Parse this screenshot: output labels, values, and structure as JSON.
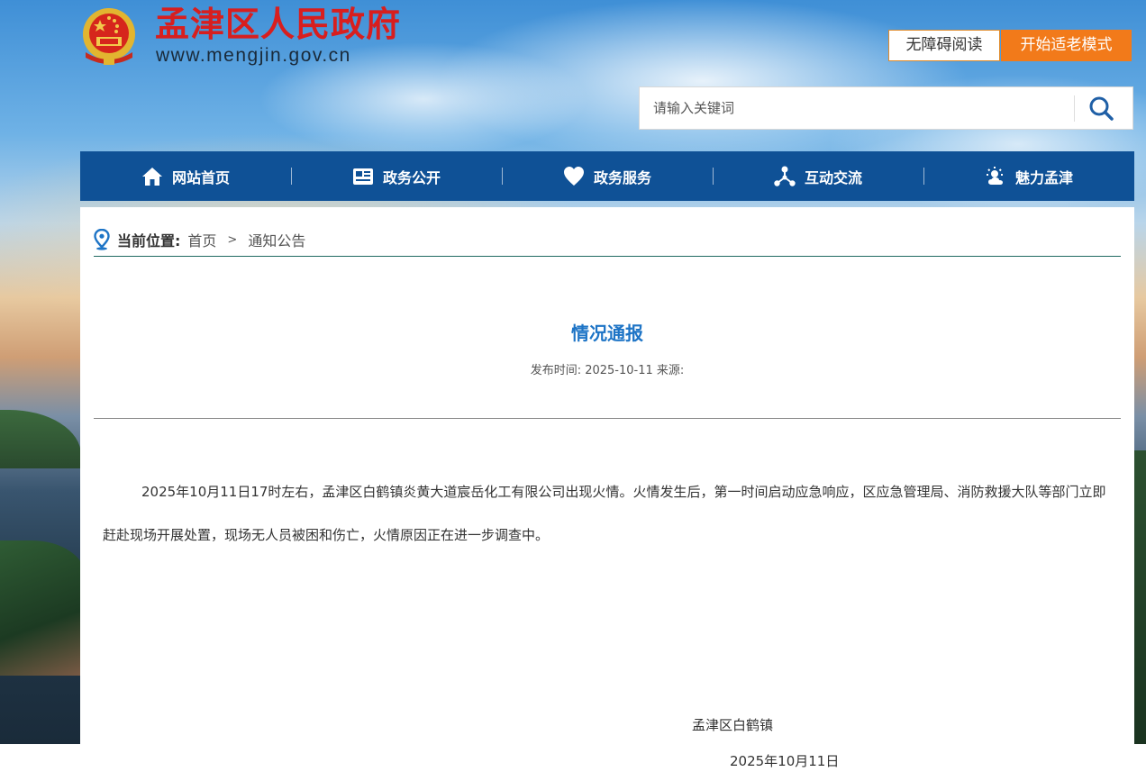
{
  "header": {
    "site_title": "孟津区人民政府",
    "site_url": "www.mengjin.gov.cn",
    "accessibility_label": "无障碍阅读",
    "elder_mode_label": "开始适老模式"
  },
  "search": {
    "placeholder": "请输入关键词"
  },
  "nav": {
    "items": [
      {
        "label": "网站首页",
        "icon": "home-icon"
      },
      {
        "label": "政务公开",
        "icon": "newspaper-icon"
      },
      {
        "label": "政务服务",
        "icon": "heart-icon"
      },
      {
        "label": "互动交流",
        "icon": "network-icon"
      },
      {
        "label": "魅力孟津",
        "icon": "sun-cloud-icon"
      }
    ]
  },
  "breadcrumb": {
    "label": "当前位置:",
    "home": "首页",
    "separator": ">",
    "current": "通知公告"
  },
  "article": {
    "title": "情况通报",
    "meta": "发布时间: 2025-10-11 来源:",
    "body": "2025年10月11日17时左右，孟津区白鹤镇炎黄大道宸岳化工有限公司出现火情。火情发生后，第一时间启动应急响应，区应急管理局、消防救援大队等部门立即赶赴现场开展处置，现场无人员被困和伤亡，火情原因正在进一步调查中。",
    "signature_org": "孟津区白鹤镇",
    "signature_date": "2025年10月11日"
  },
  "colors": {
    "nav_bg": "#0f5196",
    "title_red": "#d81e1e",
    "elder_btn": "#f27a1a",
    "article_title": "#1d74c6"
  }
}
